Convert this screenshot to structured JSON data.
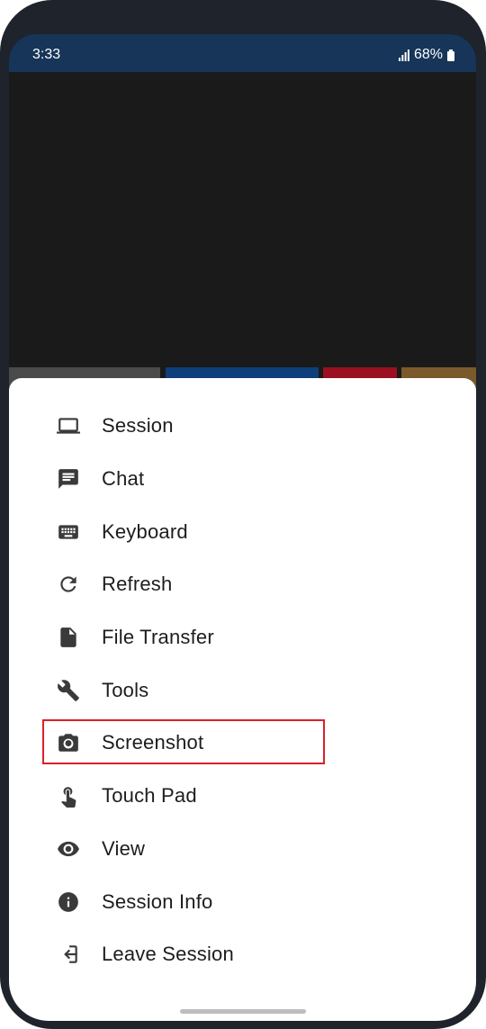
{
  "status": {
    "time": "3:33",
    "battery": "68%",
    "signal_icon": "signal-icon",
    "battery_icon": "battery-icon"
  },
  "menu": {
    "items": [
      {
        "label": "Session",
        "icon": "laptop-icon"
      },
      {
        "label": "Chat",
        "icon": "chat-icon"
      },
      {
        "label": "Keyboard",
        "icon": "keyboard-icon"
      },
      {
        "label": "Refresh",
        "icon": "refresh-icon"
      },
      {
        "label": "File Transfer",
        "icon": "file-icon"
      },
      {
        "label": "Tools",
        "icon": "wrench-icon"
      },
      {
        "label": "Screenshot",
        "icon": "camera-icon"
      },
      {
        "label": "Touch Pad",
        "icon": "touch-icon"
      },
      {
        "label": "View",
        "icon": "eye-icon"
      },
      {
        "label": "Session Info",
        "icon": "info-icon"
      },
      {
        "label": "Leave Session",
        "icon": "exit-icon"
      }
    ],
    "highlighted": "Screenshot"
  },
  "colors": {
    "status_bar": "#163558",
    "highlight_border": "#d9202a",
    "sheet": "#ffffff"
  }
}
